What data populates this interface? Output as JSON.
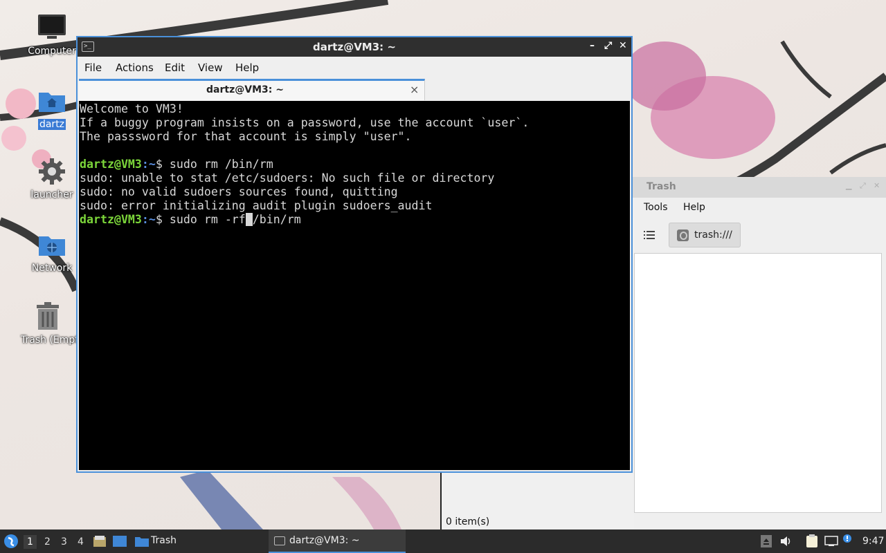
{
  "desktop": {
    "icons": [
      {
        "label": "Computer"
      },
      {
        "label": "dartz"
      },
      {
        "label": "launcher"
      },
      {
        "label": "Network"
      },
      {
        "label": "Trash (Empty)"
      }
    ]
  },
  "terminal": {
    "title": "dartz@VM3: ~",
    "menu": {
      "file": "File",
      "actions": "Actions",
      "edit": "Edit",
      "view": "View",
      "help": "Help"
    },
    "tab_label": "dartz@VM3: ~",
    "tab_close": "×",
    "lines": {
      "l1": "Welcome to VM3!",
      "l2": "If a buggy program insists on a password, use the account `user`.",
      "l3": "The passsword for that account is simply \"user\".",
      "prompt_user": "dartz@VM3",
      "prompt_path": ":~",
      "prompt_sym": "$ ",
      "cmd1": "sudo rm /bin/rm",
      "o1": "sudo: unable to stat /etc/sudoers: No such file or directory",
      "o2": "sudo: no valid sudoers sources found, quitting",
      "o3": "sudo: error initializing audit plugin sudoers_audit",
      "cmd2_before": "sudo rm -rf",
      "cmd2_cursor": " ",
      "cmd2_after": "/bin/rm"
    }
  },
  "trash": {
    "title": "Trash",
    "menu": {
      "tools": "Tools",
      "help": "Help"
    },
    "path": "trash:///",
    "status": "0 item(s)"
  },
  "taskbar": {
    "workspaces": [
      "1",
      "2",
      "3",
      "4"
    ],
    "trash_task": "Trash",
    "terminal_task": "dartz@VM3: ~",
    "clock": "9:47"
  },
  "colors": {
    "accent": "#4a90d9",
    "prompt_user": "#7cd63a",
    "prompt_path": "#5a8fe0",
    "terminal_bg": "#000000",
    "taskbar_bg": "#2b2b2b"
  }
}
